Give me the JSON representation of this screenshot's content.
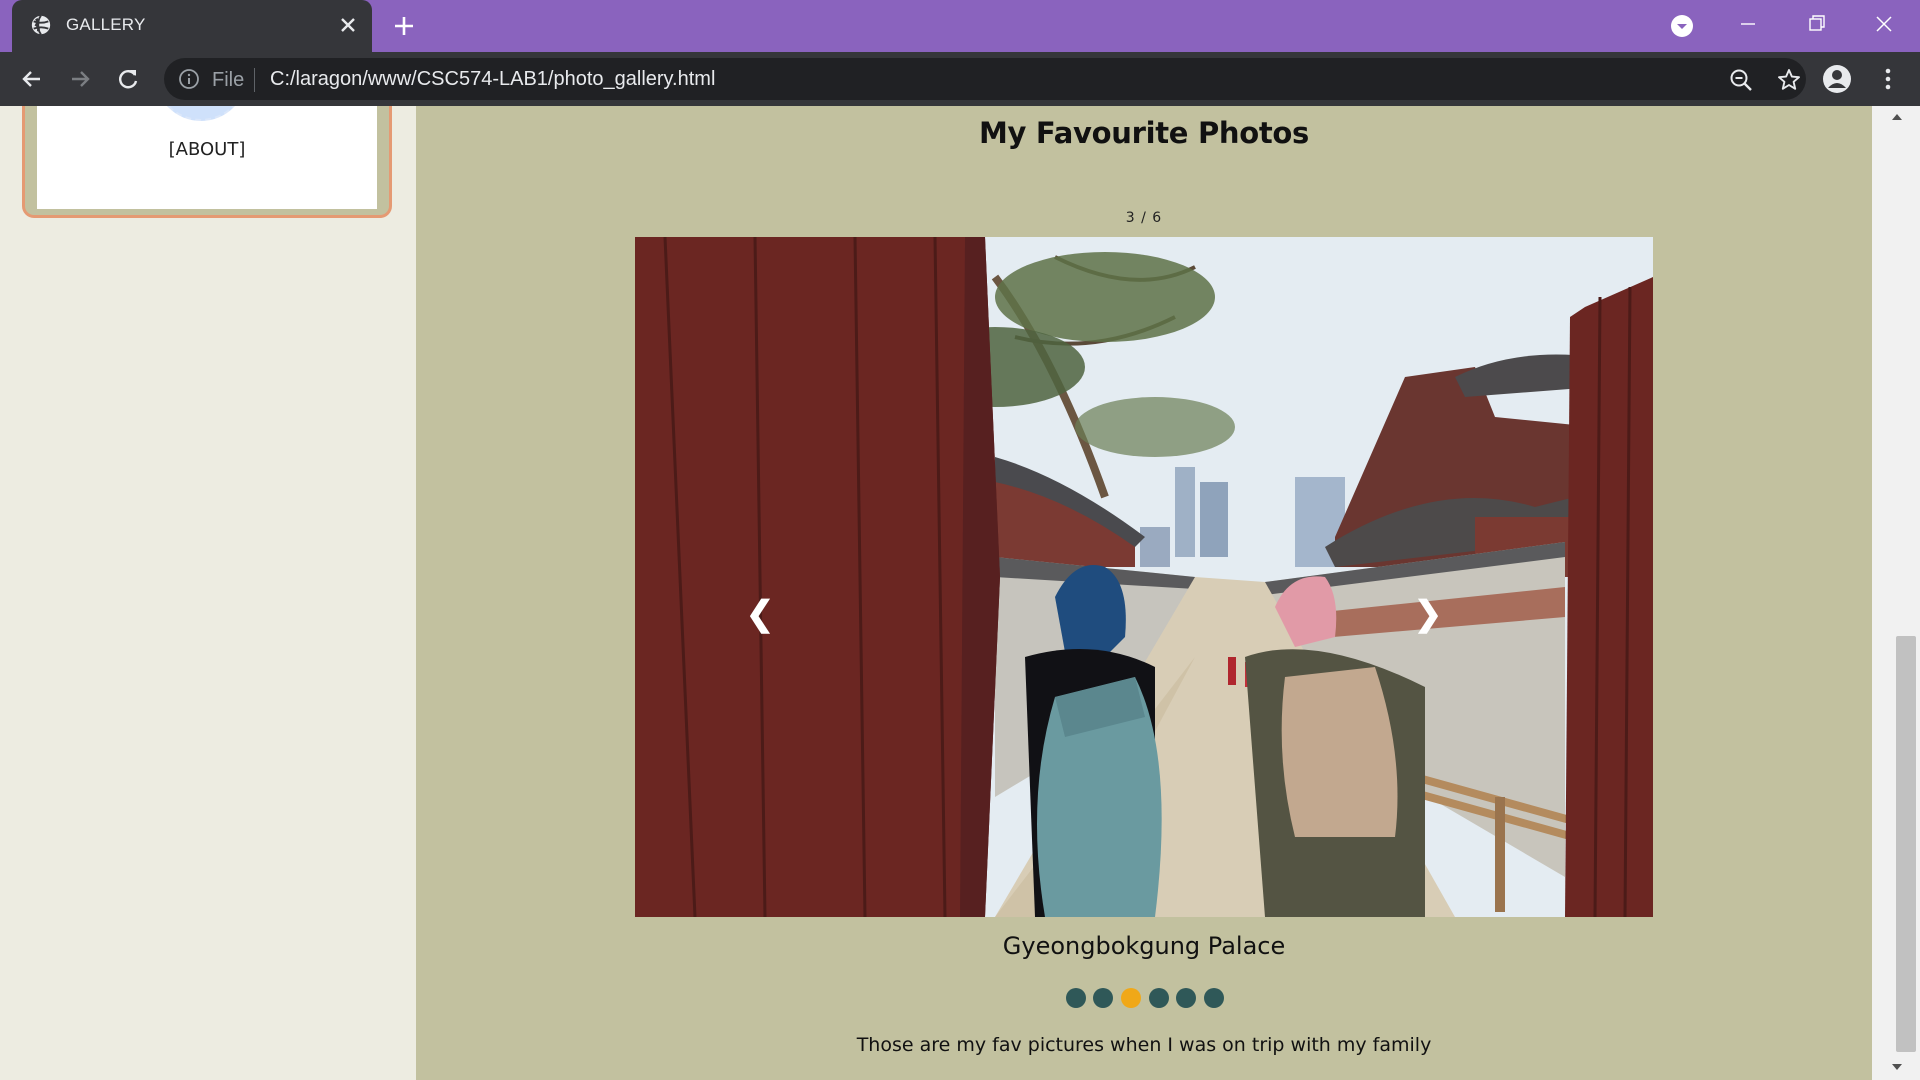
{
  "browser": {
    "tab_title": "GALLERY",
    "scheme_label": "File",
    "url": "C:/laragon/www/CSC574-LAB1/photo_gallery.html",
    "accent_color": "#8a63be"
  },
  "icons": {
    "favicon": "globe-icon",
    "tab_close": "close-icon",
    "new_tab": "plus-icon",
    "back": "arrow-left-icon",
    "forward": "arrow-right-icon",
    "reload": "reload-icon",
    "site_info": "info-icon",
    "zoom": "zoom-out-icon",
    "bookmark": "star-icon",
    "profile": "person-icon",
    "menu": "kebab-menu-icon"
  },
  "sidebar": {
    "about_link": "[ABOUT]"
  },
  "gallery": {
    "title": "My Favourite Photos",
    "counter": "3 / 6",
    "caption": "Gyeongbokgung Palace",
    "prev_label": "❮",
    "next_label": "❯",
    "total_slides": 6,
    "active_slide": 3,
    "description": "Those are my fav pictures when I was on trip with my family",
    "dot_color": "#2f5858",
    "active_dot_color": "#f0a818"
  },
  "colors": {
    "main_background": "#c2c19f",
    "sidebar_background": "#edece1",
    "card_border": "#e59a73"
  }
}
